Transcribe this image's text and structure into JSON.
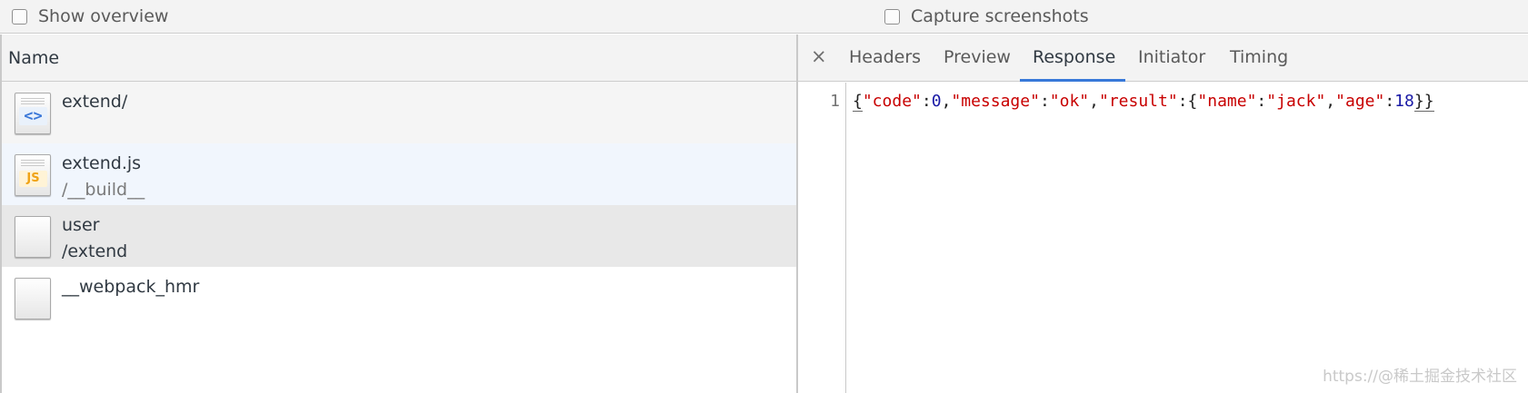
{
  "options": {
    "show_overview": "Show overview",
    "capture_screenshots": "Capture screenshots"
  },
  "requests": {
    "header": "Name",
    "rows": [
      {
        "name": "extend/",
        "path": "",
        "icon": "html-file-icon",
        "glyph": "<>"
      },
      {
        "name": "extend.js",
        "path": "/__build__",
        "icon": "js-file-icon",
        "glyph": "JS"
      },
      {
        "name": "user",
        "path": "/extend",
        "icon": "generic-file-icon"
      },
      {
        "name": "__webpack_hmr",
        "path": "",
        "icon": "generic-file-icon"
      }
    ]
  },
  "details": {
    "close": "×",
    "tabs": [
      "Headers",
      "Preview",
      "Response",
      "Initiator",
      "Timing"
    ],
    "active_tab": "Response",
    "line_number": "1",
    "response": {
      "open_brace": "{",
      "k_code": "\"code\"",
      "v_code": "0",
      "k_message": "\"message\"",
      "v_message": "\"ok\"",
      "k_result": "\"result\"",
      "k_name": "\"name\"",
      "v_name": "\"jack\"",
      "k_age": "\"age\"",
      "v_age": "18",
      "close_braces": "}}"
    }
  },
  "watermark": "https://@稀土掘金技术社区",
  "colors": {
    "accent": "#3879d9",
    "json_key": "#c80000",
    "json_number": "#1a1aa6"
  }
}
